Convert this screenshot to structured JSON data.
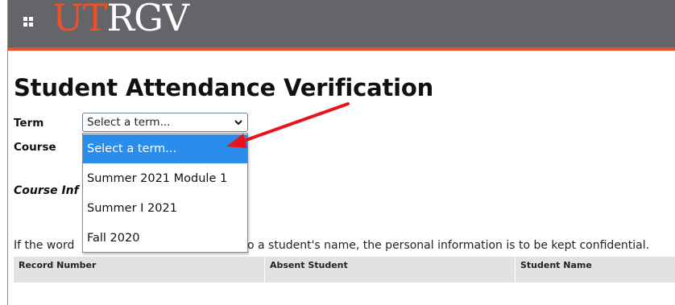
{
  "header": {
    "logo_ut": "UT",
    "logo_rgv": "RGV"
  },
  "page": {
    "title": "Student Attendance Verification"
  },
  "form": {
    "term_label": "Term",
    "course_label": "Course",
    "course_info_label": "Course Inf",
    "term_select": {
      "selected": "Select a term...",
      "options": [
        "Select a term...",
        "Summer 2021 Module 1",
        "Summer I 2021",
        "Fall 2020"
      ]
    }
  },
  "notice": {
    "start": "If the word",
    "end": "o a student's name, the personal information is to be kept confidential."
  },
  "table": {
    "headers": [
      "Record Number",
      "Absent Student",
      "Student Name"
    ]
  },
  "colors": {
    "topbar": "#646569",
    "accent_orange": "#f05023",
    "highlight_blue": "#2a8ceb",
    "annotation_arrow": "#e8141b"
  },
  "icons": {
    "menu": "grid-icon",
    "select": "chevron-down-icon",
    "annotation": "red-arrow-annotation"
  }
}
